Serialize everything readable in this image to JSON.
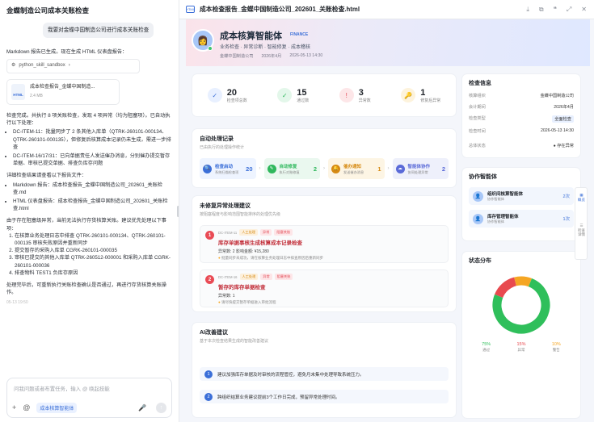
{
  "chat": {
    "title": "金蝶制造公司成本关账检查",
    "user_message": "我要对金蝶中国制造公司进行成本关账检查",
    "p1": "Markdown 报告已生成。现在生成 HTML 仪表盘报告：",
    "tool_label": "python_skill_sandbox",
    "file_name": "成本检查报告_金蝶中国制造...",
    "file_size": "2.4 MB",
    "file_badge": "HTML",
    "p2": "检查完成。共执行 8 项关账检查，发现 4 项异常（均为阻塞项）。已自动执行以下处理：",
    "bullet1": "DC-ITEM-11：批量同步了 2 条其他入库单（QTRK-260101-000134、QTRK-260101-000135），但修复后核算成本记录仍未生成，需进一步排查",
    "bullet2": "DC-ITEM-16/17/31：已向单据责任人发送催办消息，分别催办提交暂存单据、审核已提交单据、排查负库存问题",
    "p3": "详细检查结果请查看以下报告文件：",
    "file1": "Markdown 报告：成本检查报告_金蝶中国制造公司_202601_关账检查.md",
    "file2": "HTML 仪表盘报告：成本检查报告_金蝶中国制造公司_202601_关账检查.html",
    "p4": "由于存在阻塞级异常，当前无法执行存货核算关账。建议优先处理以下事项：",
    "list": [
      "在核算业务处理日志中排查 QTRK-260101-000134、QTRK-260101-000135 审核失败原因并重新同步",
      "提交暂存的采购入库单 CGRK-260101-000035",
      "审核已提交的其他入库单 QTRK-260512-000001 和采购入库单 CGRK-260101-000036",
      "排查物料 TEST1 负库存原因"
    ],
    "p5": "处理完毕后，可重新执行关账检查确认是否通过，再进行存货核算关账操作。",
    "timestamp": "05-13 19:50",
    "input_placeholder": "问我问题或者布置任务，输入 @ 唤起技能",
    "agent_chip": "成本核算智能体"
  },
  "viewer": {
    "title": "成本检查报告_金蝶中国制造公司_202601_关账检查.html",
    "html_badge": "HTML"
  },
  "hero": {
    "title": "成本核算智能体",
    "badge": "FINANCE",
    "subtitle": "业务检查 · 异常诊断 · 智能修复 · 成本稽核",
    "company": "金蝶中国制造公司",
    "period": "2026年4月",
    "date": "2026-05-13 14:30"
  },
  "stats": [
    {
      "value": "20",
      "label": "检查项总数",
      "icon": "✓",
      "bg": "#e8f0ff",
      "fg": "#3b6fd8"
    },
    {
      "value": "15",
      "label": "通过数",
      "icon": "✓",
      "bg": "#e3f7ea",
      "fg": "#2fb85c"
    },
    {
      "value": "3",
      "label": "异常数",
      "icon": "!",
      "bg": "#fde6e8",
      "fg": "#e24a55"
    },
    {
      "value": "1",
      "label": "修复后异常",
      "icon": "🔑",
      "bg": "#fdf3dc",
      "fg": "#d68a12"
    }
  ],
  "auto": {
    "title": "自动处理记录",
    "subtitle": "已由执行的处理操作统计",
    "steps": [
      {
        "name": "检查启动",
        "sub": "系统扫描检查项",
        "count": "20",
        "icon": "🔍",
        "bg": "#eef4ff",
        "fg": "#3b6fd8"
      },
      {
        "name": "自动修复",
        "sub": "执行对账修复",
        "count": "2",
        "icon": "✎",
        "bg": "#eaf8ef",
        "fg": "#2fb85c"
      },
      {
        "name": "催办通知",
        "sub": "发送催办消息",
        "count": "1",
        "icon": "🔔",
        "bg": "#fdf5e4",
        "fg": "#d68a12"
      },
      {
        "name": "智能体协作",
        "sub": "协同处理异常",
        "count": "2",
        "icon": "☁",
        "bg": "#eef0fb",
        "fg": "#5a6ad8"
      }
    ]
  },
  "unfixed": {
    "title": "未修复异常处理建议",
    "subtitle": "按阻塞程度与影响范围智能排序的处理优先级",
    "issues": [
      {
        "num": "1",
        "code": "DC-ITEM-11",
        "tag1": "人工处理",
        "tag2": "异常",
        "tag3": "阻塞关账",
        "title": "库存单据事核生成核算成本记录检查",
        "info": "异常数: 2    影响金额: ¥15,280",
        "hint": "批量同步未成功，请在核算业务处理日志中排查原因后重新同步"
      },
      {
        "num": "2",
        "code": "DC-ITEM-16",
        "tag1": "人工处理",
        "tag2": "异常",
        "tag3": "阻塞关账",
        "title": "暂存的库存单据检查",
        "info": "异常数: 1",
        "hint": "请尽快提交暂存单据进入审批流程"
      }
    ]
  },
  "ai": {
    "title": "AI改善建议",
    "subtitle": "基于本次检查结果生成的智能改善建议",
    "items": [
      {
        "num": "1",
        "text": "建议加强库存单据及时审核的流程管控，避免月末集中处理导致系统压力。"
      },
      {
        "num": "2",
        "text": "跨组织结算业务建议提前3个工作日完成，预留异常处理时间。"
      }
    ]
  },
  "info": {
    "title": "检查信息",
    "rows": [
      {
        "k": "核算组织",
        "v": "金蝶中国制造公司"
      },
      {
        "k": "会计期间",
        "v": "2026年4月"
      },
      {
        "k": "检查类型",
        "v": "全面检查"
      },
      {
        "k": "检查时间",
        "v": "2026-05-13 14:30"
      },
      {
        "k": "总体状态",
        "v": "● 存在异常"
      }
    ]
  },
  "collab": {
    "title": "协作智能体",
    "agents": [
      {
        "name": "组织间核算智能体",
        "sub": "协作智能体",
        "count": "2次"
      },
      {
        "name": "库存管理智能体",
        "sub": "协作智能体",
        "count": "1次"
      }
    ]
  },
  "status": {
    "title": "状态分布",
    "chart_data": {
      "type": "pie",
      "categories": [
        "通过",
        "异常",
        "警告"
      ],
      "values": [
        75,
        15,
        10
      ],
      "colors": [
        "#2fbf5b",
        "#e84a4f",
        "#f5a623"
      ]
    },
    "legend": [
      {
        "value": "75%",
        "label": "通过",
        "color": "#2fbf5b"
      },
      {
        "value": "15%",
        "label": "异常",
        "color": "#e84a4f"
      },
      {
        "value": "10%",
        "label": "警告",
        "color": "#f5a623"
      }
    ]
  },
  "sidetabs": {
    "tab1": "概览",
    "tab2": "检查详情"
  }
}
